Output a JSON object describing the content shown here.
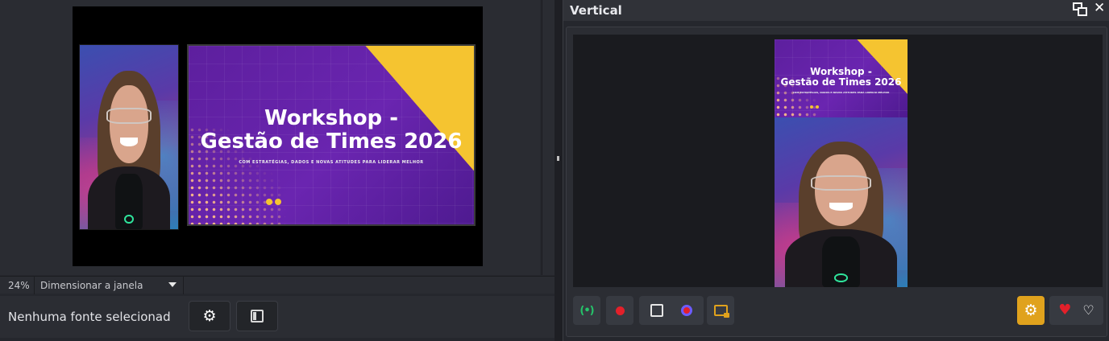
{
  "left": {
    "zoom_percent": "24%",
    "zoom_mode": "Dimensionar a janela",
    "source_status": "Nenhuma fonte selecionad"
  },
  "slide": {
    "title_line1": "Workshop -",
    "title_line2": "Gestão de Times 2026",
    "subtitle": "COM ESTRATÉGIAS, DADOS E NOVAS ATITUDES PARA LIDERAR MELHOR"
  },
  "right": {
    "title": "Vertical"
  },
  "colors": {
    "accent": "#e0a21d",
    "record": "#e3202a",
    "stream": "#25c46a",
    "slide_purple": "#6a25b0",
    "slide_yellow": "#f5c430"
  },
  "icons": {
    "settings": "gear-icon",
    "panel": "panel-icon",
    "popout": "popout-icon",
    "close": "close-icon",
    "stream": "stream-icon",
    "record": "record-icon",
    "studio": "studio-mode-icon",
    "virtual_cam": "virtual-camera-icon",
    "screen": "screen-capture-icon",
    "heart": "heart-icon",
    "heart_outline": "heart-outline-icon"
  }
}
